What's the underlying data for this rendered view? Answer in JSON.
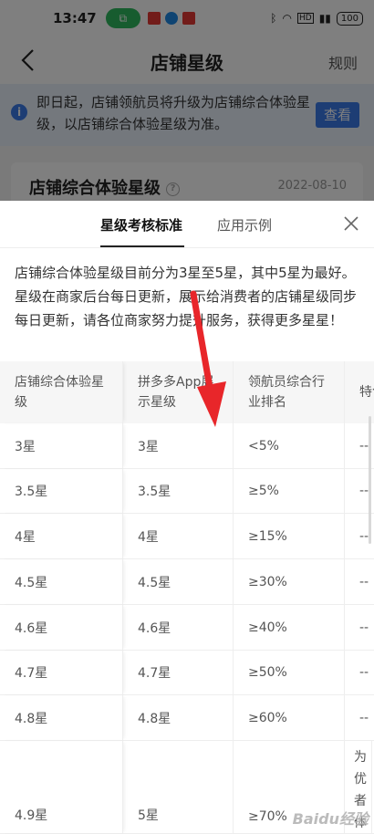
{
  "status": {
    "time": "13:47",
    "battery": "100"
  },
  "header": {
    "title": "店铺星级",
    "rules_label": "规则"
  },
  "notice": {
    "text": "即日起，店铺领航员将升级为店铺综合体验星级，以店铺综合体验星级为准。",
    "button": "查看"
  },
  "card": {
    "title": "店铺综合体验星级",
    "date": "2022-08-10"
  },
  "sheet": {
    "tabs": [
      {
        "label": "星级考核标准"
      },
      {
        "label": "应用示例"
      }
    ],
    "description": "店铺综合体验星级目前分为3星至5星，其中5星为最好。星级在商家后台每日更新，展示给消费者的店铺星级同步每日更新，请各位商家努力提升服务，获得更多星星！",
    "table": {
      "headers": [
        "店铺综合体验星级",
        "拼多多App展示星级",
        "领航员综合行业排名",
        "特色"
      ],
      "rows": [
        [
          "3星",
          "3星",
          "<5%",
          "--"
        ],
        [
          "3.5星",
          "3.5星",
          "≥5%",
          "--"
        ],
        [
          "4星",
          "4星",
          "≥15%",
          "--"
        ],
        [
          "4.5星",
          "4.5星",
          "≥30%",
          "--"
        ],
        [
          "4.6星",
          "4.6星",
          "≥40%",
          "--"
        ],
        [
          "4.7星",
          "4.7星",
          "≥50%",
          "--"
        ],
        [
          "4.8星",
          "4.8星",
          "≥60%",
          "--"
        ],
        [
          "4.9星",
          "5星",
          "≥70%",
          "为优者体星/有五"
        ]
      ]
    }
  },
  "watermark": "Baidu经验",
  "colors": {
    "accent": "#3b7be8",
    "status_pill": "#2fb85e",
    "arrow": "#e8262a"
  }
}
